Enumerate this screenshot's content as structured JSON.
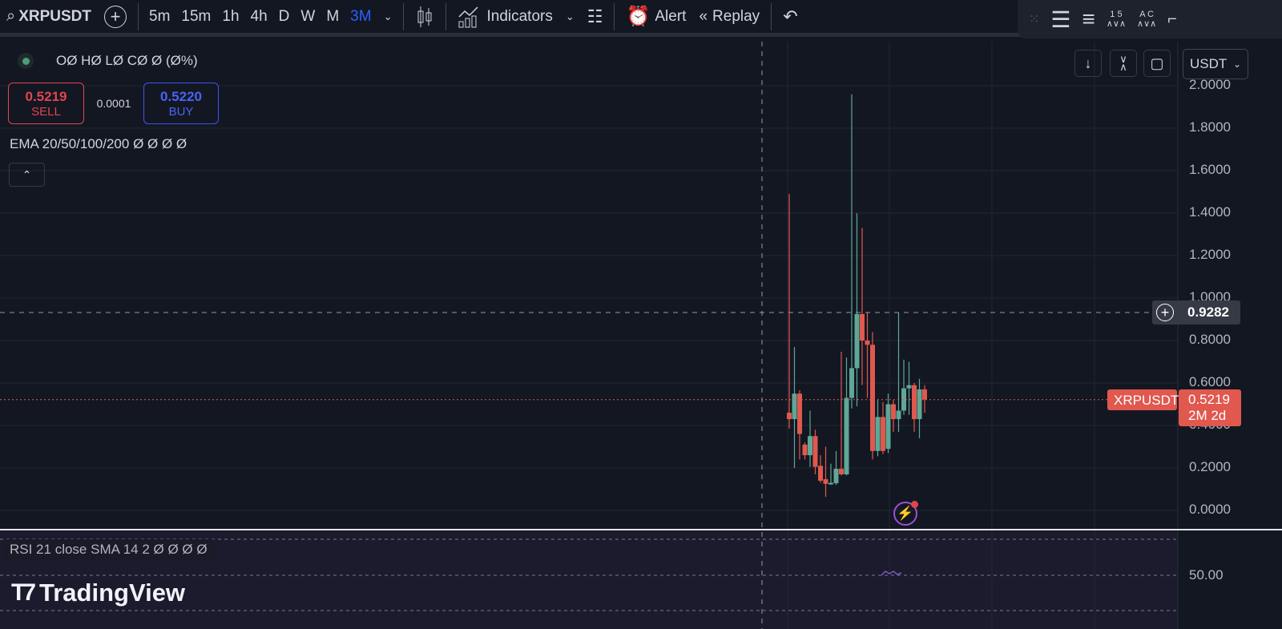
{
  "toolbar": {
    "symbol": "XRPUSDT",
    "timeframes": [
      "5m",
      "15m",
      "1h",
      "4h",
      "D",
      "W",
      "M",
      "3M"
    ],
    "active_timeframe": "3M",
    "indicators": "Indicators",
    "alert": "Alert",
    "replay": "Replay"
  },
  "drawing_toolbar": {
    "label_15": "1 5",
    "label_ac": "A C"
  },
  "legend": {
    "ohlc": "OØ HØ LØ CØ Ø (Ø%)",
    "sell_price": "0.5219",
    "sell_label": "SELL",
    "spread": "0.0001",
    "buy_price": "0.5220",
    "buy_label": "BUY",
    "ema": "EMA 20/50/100/200  Ø  Ø  Ø  Ø"
  },
  "currency": "USDT",
  "price_axis": [
    "2.0000",
    "1.8000",
    "1.6000",
    "1.4000",
    "1.2000",
    "1.0000",
    "0.8000",
    "0.6000",
    "0.4000",
    "0.2000",
    "0.0000"
  ],
  "crosshair": {
    "price": "0.9282"
  },
  "last_price": {
    "symbol": "XRPUSDT",
    "price": "0.5219",
    "countdown": "2M 2d"
  },
  "rsi": {
    "legend": "RSI 21 close SMA 14 2  Ø  Ø  Ø  Ø",
    "level": "50.00"
  },
  "logo": "TradingView",
  "colors": {
    "up": "#5fa796",
    "down": "#e0584e",
    "accent": "#2962ff"
  },
  "chart_data": {
    "type": "candlestick",
    "symbol": "XRPUSDT",
    "interval": "3M",
    "ylim": [
      0,
      2.0
    ],
    "ohlc": [
      [
        0.46,
        1.49,
        0.385,
        0.43
      ],
      [
        0.43,
        0.77,
        0.2,
        0.55
      ],
      [
        0.55,
        0.566,
        0.24,
        0.36
      ],
      [
        0.31,
        0.32,
        0.24,
        0.26
      ],
      [
        0.26,
        0.47,
        0.205,
        0.35
      ],
      [
        0.35,
        0.38,
        0.17,
        0.205
      ],
      [
        0.21,
        0.26,
        0.13,
        0.14
      ],
      [
        0.147,
        0.3,
        0.064,
        0.125
      ],
      [
        0.125,
        0.22,
        0.12,
        0.13
      ],
      [
        0.128,
        0.28,
        0.12,
        0.196
      ],
      [
        0.196,
        0.747,
        0.165,
        0.17
      ],
      [
        0.17,
        0.72,
        0.165,
        0.53
      ],
      [
        0.53,
        1.96,
        0.48,
        0.67
      ],
      [
        0.67,
        1.4,
        0.49,
        0.925
      ],
      [
        0.925,
        1.33,
        0.59,
        0.8
      ],
      [
        0.8,
        0.93,
        0.53,
        0.78
      ],
      [
        0.78,
        0.84,
        0.24,
        0.28
      ],
      [
        0.28,
        0.52,
        0.255,
        0.44
      ],
      [
        0.44,
        0.51,
        0.265,
        0.28
      ],
      [
        0.29,
        0.55,
        0.27,
        0.5
      ],
      [
        0.5,
        0.52,
        0.37,
        0.43
      ],
      [
        0.43,
        0.93,
        0.37,
        0.47
      ],
      [
        0.47,
        0.71,
        0.45,
        0.575
      ],
      [
        0.575,
        0.7,
        0.45,
        0.59
      ],
      [
        0.59,
        0.6,
        0.37,
        0.43
      ],
      [
        0.43,
        0.62,
        0.34,
        0.57
      ],
      [
        0.57,
        0.59,
        0.46,
        0.5219
      ]
    ]
  }
}
